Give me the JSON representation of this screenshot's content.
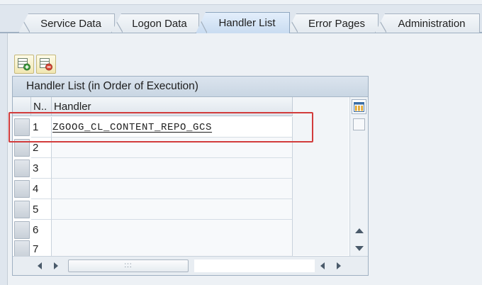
{
  "tabs": [
    {
      "label": "Service Data",
      "active": false
    },
    {
      "label": "Logon Data",
      "active": false
    },
    {
      "label": "Handler List",
      "active": true
    },
    {
      "label": "Error Pages",
      "active": false
    },
    {
      "label": "Administration",
      "active": false
    }
  ],
  "toolbar": {
    "insert_row_icon": "insert-row-icon",
    "delete_row_icon": "delete-row-icon"
  },
  "grid": {
    "title": "Handler List (in Order of Execution)",
    "columns": {
      "number": "N..",
      "handler": "Handler"
    },
    "rows": [
      {
        "number": "1",
        "handler": "ZGOOG_CL_CONTENT_REPO_GCS"
      },
      {
        "number": "2",
        "handler": ""
      },
      {
        "number": "3",
        "handler": ""
      },
      {
        "number": "4",
        "handler": ""
      },
      {
        "number": "5",
        "handler": ""
      },
      {
        "number": "6",
        "handler": ""
      },
      {
        "number": "7",
        "handler": ""
      }
    ],
    "column_settings_icon": "table-settings-icon",
    "grip_label": ":::"
  },
  "colors": {
    "active_tab": "#c9dcf1",
    "highlight_box": "#d23c3c",
    "toolbar_button": "#f1e7b2"
  }
}
